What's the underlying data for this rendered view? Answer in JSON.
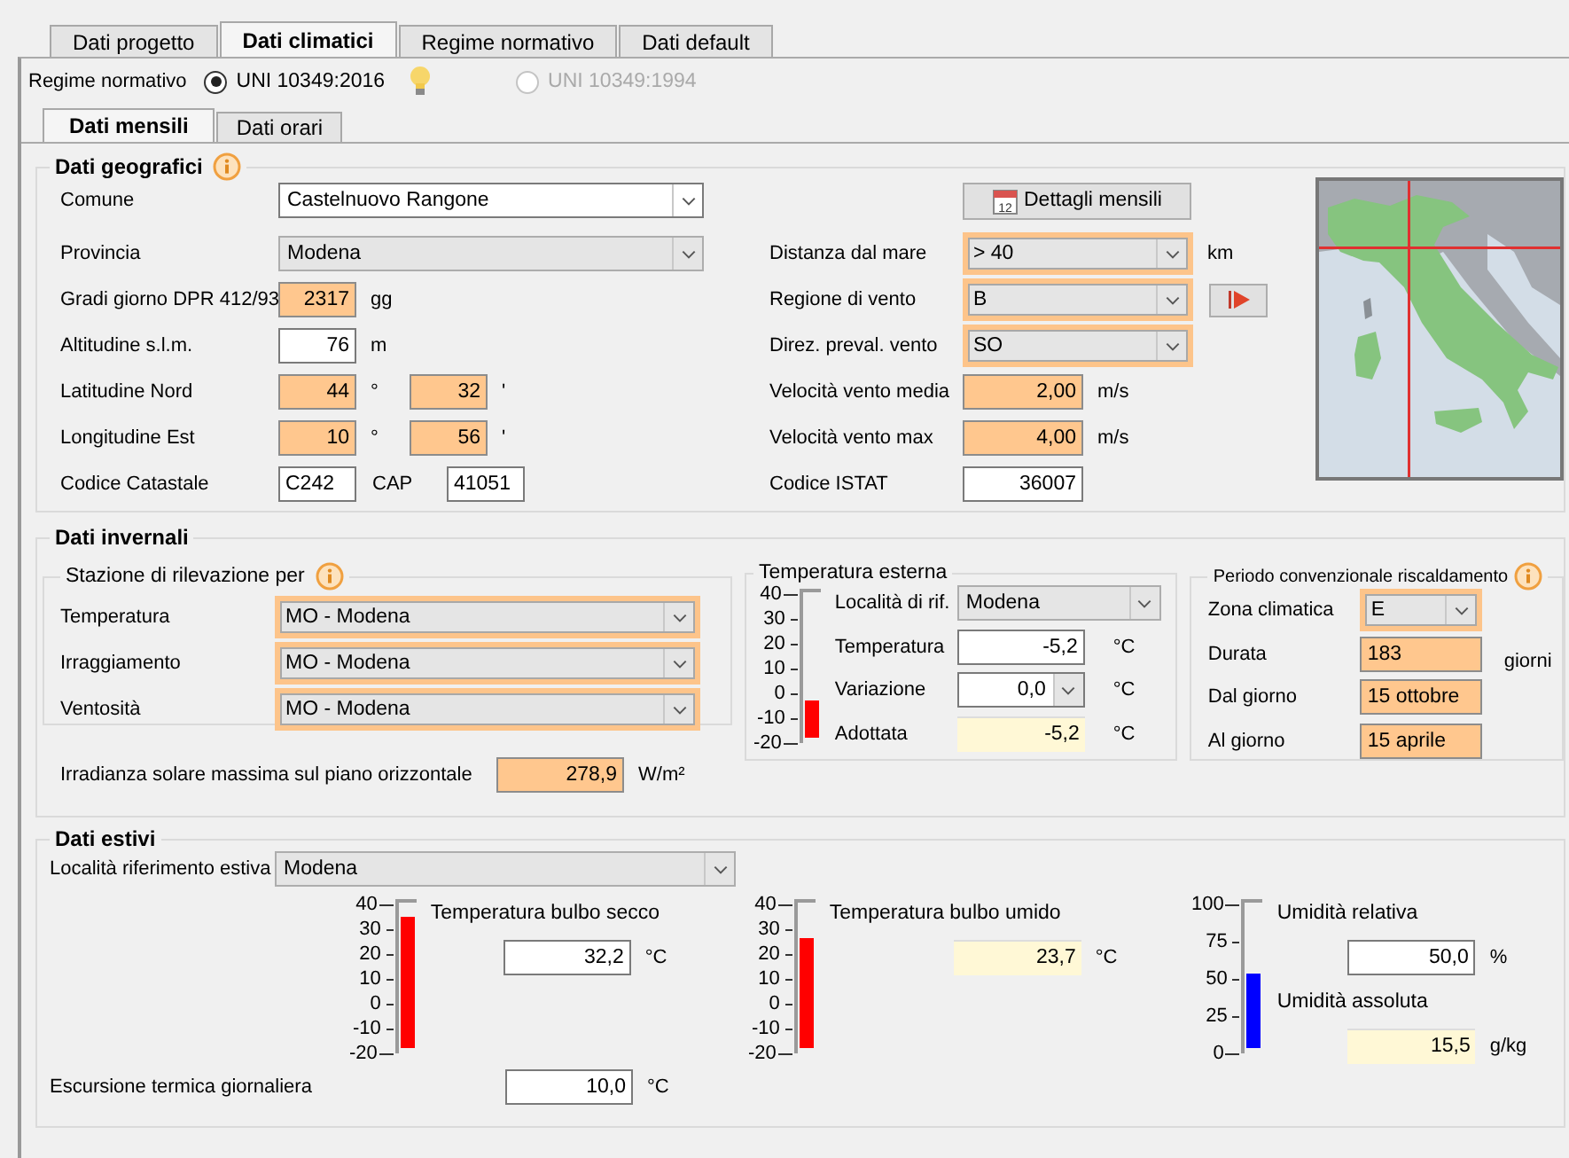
{
  "tabs": [
    {
      "label": "Dati progetto",
      "selected": false
    },
    {
      "label": "Dati climatici",
      "selected": true
    },
    {
      "label": "Regime normativo",
      "selected": false
    },
    {
      "label": "Dati default",
      "selected": false
    }
  ],
  "regime": {
    "label": "Regime normativo",
    "options": [
      {
        "label": "UNI 10349:2016",
        "selected": true,
        "disabled": false
      },
      {
        "label": "UNI 10349:1994",
        "selected": false,
        "disabled": true
      }
    ]
  },
  "subtabs": [
    {
      "label": "Dati mensili",
      "selected": true
    },
    {
      "label": "Dati orari",
      "selected": false
    }
  ],
  "geo": {
    "title": "Dati geografici",
    "left": [
      {
        "label": "Comune",
        "fields": [
          {
            "kind": "combo-edit",
            "value": "Castelnuovo Rangone",
            "highlighted": false
          }
        ]
      },
      {
        "label": "Provincia",
        "fields": [
          {
            "kind": "combo",
            "value": "Modena",
            "highlighted": false
          }
        ]
      },
      {
        "label": "Gradi giorno DPR 412/93",
        "fields": [
          {
            "kind": "computed",
            "value": "2317",
            "unit": "gg"
          }
        ]
      },
      {
        "label": "Altitudine s.l.m.",
        "fields": [
          {
            "kind": "input",
            "value": "76",
            "unit": "m"
          }
        ]
      },
      {
        "label": "Latitudine Nord",
        "fields": [
          {
            "kind": "computed",
            "value": "44",
            "unit": "°"
          },
          {
            "kind": "computed",
            "value": "32",
            "unit": "'"
          }
        ]
      },
      {
        "label": "Longitudine Est",
        "fields": [
          {
            "kind": "computed",
            "value": "10",
            "unit": "°"
          },
          {
            "kind": "computed",
            "value": "56",
            "unit": "'"
          }
        ]
      },
      {
        "label": "Codice Catastale",
        "fields": [
          {
            "kind": "input-text",
            "value": "C242"
          },
          {
            "kind": "caption",
            "value": "CAP"
          },
          {
            "kind": "input-text",
            "value": "41051"
          }
        ]
      }
    ],
    "button": {
      "label": "Dettagli mensili",
      "calendar_day": "12"
    },
    "right": [
      {
        "label": "Distanza dal mare",
        "fields": [
          {
            "kind": "combo",
            "value": "> 40",
            "highlighted": true,
            "unit": "km"
          }
        ]
      },
      {
        "label": "Regione di vento",
        "play_button": true,
        "fields": [
          {
            "kind": "combo",
            "value": "B",
            "highlighted": true
          }
        ]
      },
      {
        "label": "Direz. preval. vento",
        "fields": [
          {
            "kind": "combo",
            "value": "SO",
            "highlighted": true
          }
        ]
      },
      {
        "label": "Velocità vento media",
        "fields": [
          {
            "kind": "computed",
            "value": "2,00",
            "unit": "m/s"
          }
        ]
      },
      {
        "label": "Velocità vento max",
        "fields": [
          {
            "kind": "computed",
            "value": "4,00",
            "unit": "m/s"
          }
        ]
      },
      {
        "label": "Codice ISTAT",
        "fields": [
          {
            "kind": "input",
            "value": "36007"
          }
        ]
      }
    ]
  },
  "winter": {
    "title": "Dati invernali",
    "stations": {
      "title": "Stazione di rilevazione per",
      "rows": [
        {
          "label": "Temperatura",
          "field": {
            "kind": "combo",
            "value": "MO - Modena",
            "highlighted": true
          }
        },
        {
          "label": "Irraggiamento",
          "field": {
            "kind": "combo",
            "value": "MO - Modena",
            "highlighted": true
          }
        },
        {
          "label": "Ventosità",
          "field": {
            "kind": "combo",
            "value": "MO - Modena",
            "highlighted": true
          }
        }
      ]
    },
    "irradiance": {
      "label": "Irradianza solare massima sul piano orizzontale",
      "field": {
        "kind": "computed",
        "value": "278,9"
      },
      "unit": "W/m²"
    },
    "external": {
      "title": "Temperatura esterna",
      "gauge": {
        "scale": [
          "40",
          "30",
          "20",
          "10",
          "0",
          "-10",
          "-20"
        ],
        "level": 0.25,
        "color": "#ff0000"
      },
      "rows": [
        {
          "label": "Località di rif.",
          "field": {
            "kind": "combo",
            "value": "Modena",
            "highlighted": false
          }
        },
        {
          "label": "Temperatura",
          "field": {
            "kind": "input",
            "value": "-5,2"
          },
          "unit": "°C"
        },
        {
          "label": "Variazione",
          "field": {
            "kind": "spin",
            "value": "0,0"
          },
          "unit": "°C"
        },
        {
          "label": "Adottata",
          "field": {
            "kind": "derived",
            "value": "-5,2"
          },
          "unit": "°C"
        }
      ]
    },
    "period": {
      "title": "Periodo convenzionale riscaldamento",
      "rows": [
        {
          "label": "Zona climatica",
          "field": {
            "kind": "combo",
            "value": "E",
            "highlighted": true
          }
        },
        {
          "label": "Durata",
          "field": {
            "kind": "computed-text",
            "value": "183"
          },
          "unit": "giorni"
        },
        {
          "label": "Dal giorno",
          "field": {
            "kind": "computed-text",
            "value": "15 ottobre"
          }
        },
        {
          "label": "Al giorno",
          "field": {
            "kind": "computed-text",
            "value": "15 aprile"
          }
        }
      ]
    }
  },
  "summer": {
    "title": "Dati estivi",
    "location": {
      "label": "Località riferimento estiva",
      "field": {
        "kind": "combo",
        "value": "Modena",
        "highlighted": false
      }
    },
    "blocks": [
      {
        "gauge": {
          "scale": [
            "40",
            "30",
            "20",
            "10",
            "0",
            "-10",
            "-20"
          ],
          "level": 0.87,
          "color": "#ff0000"
        },
        "items": [
          {
            "label": "Temperatura bulbo secco",
            "field": {
              "kind": "input",
              "value": "32,2"
            },
            "unit": "°C"
          }
        ]
      },
      {
        "gauge": {
          "scale": [
            "40",
            "30",
            "20",
            "10",
            "0",
            "-10",
            "-20"
          ],
          "level": 0.73,
          "color": "#ff0000"
        },
        "items": [
          {
            "label": "Temperatura bulbo umido",
            "field": {
              "kind": "derived",
              "value": "23,7"
            },
            "unit": "°C"
          }
        ]
      },
      {
        "gauge": {
          "scale": [
            "100",
            "75",
            "50",
            "25",
            "0"
          ],
          "level": 0.5,
          "color": "#0000ff"
        },
        "items": [
          {
            "label": "Umidità relativa",
            "field": {
              "kind": "input",
              "value": "50,0"
            },
            "unit": "%"
          },
          {
            "label": "Umidità assoluta",
            "field": {
              "kind": "derived",
              "value": "15,5"
            },
            "unit": "g/kg"
          }
        ]
      }
    ],
    "excursion": {
      "label": "Escursione termica giornaliera",
      "field": {
        "kind": "input",
        "value": "10,0"
      },
      "unit": "°C"
    }
  }
}
